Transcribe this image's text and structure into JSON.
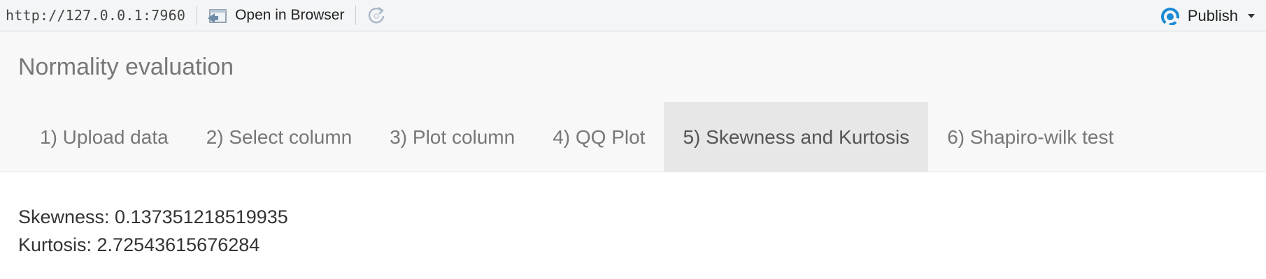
{
  "toolbar": {
    "url": "http://127.0.0.1:7960",
    "open_in_browser_label": "Open in Browser",
    "publish_label": "Publish"
  },
  "app": {
    "title": "Normality evaluation",
    "tabs": [
      {
        "label": "1) Upload data",
        "active": false
      },
      {
        "label": "2) Select column",
        "active": false
      },
      {
        "label": "3) Plot column",
        "active": false
      },
      {
        "label": "4) QQ Plot",
        "active": false
      },
      {
        "label": "5) Skewness and Kurtosis",
        "active": true
      },
      {
        "label": "6) Shapiro-wilk test",
        "active": false
      }
    ]
  },
  "results": {
    "skewness": "Skewness: 0.137351218519935",
    "kurtosis": "Kurtosis: 2.72543615676284"
  },
  "colors": {
    "publish_icon": "#1a8ad4",
    "active_tab_bg": "#e7e7e7"
  }
}
